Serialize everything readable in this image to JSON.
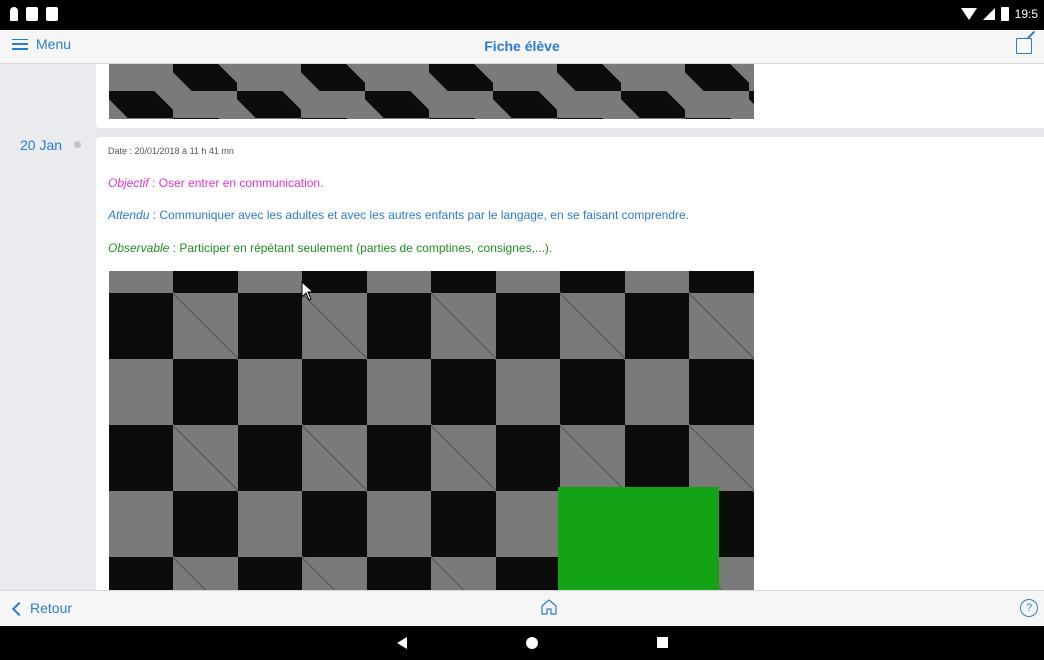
{
  "status_bar": {
    "time": "19:5",
    "icons": [
      "person-icon",
      "mail-icon",
      "sd-card-icon",
      "wifi-icon",
      "signal-icon",
      "battery-icon"
    ]
  },
  "header": {
    "menu_label": "Menu",
    "title": "Fiche élève",
    "edit_icon": "edit-icon"
  },
  "entry": {
    "date_short": "20 Jan",
    "meta_date": "Date : 20/01/2018 à 11 h 41 mn",
    "objectif_label": "Objectif",
    "objectif_text": " : Oser entrer en communication.",
    "attendu_label": "Attendu",
    "attendu_text": " : Communiquer avec les adultes et avec les autres enfants par le langage, en se faisant comprendre.",
    "observable_label": "Observable",
    "observable_text": " : Participer en répétant seulement (parties de comptines, consignes,...)."
  },
  "footer": {
    "back_label": "Retour",
    "help_symbol": "?"
  },
  "colors": {
    "accent": "#2a7bd4",
    "objectif": "#e233d6",
    "observable": "#1f8f1f",
    "green_block": "#14a314"
  }
}
